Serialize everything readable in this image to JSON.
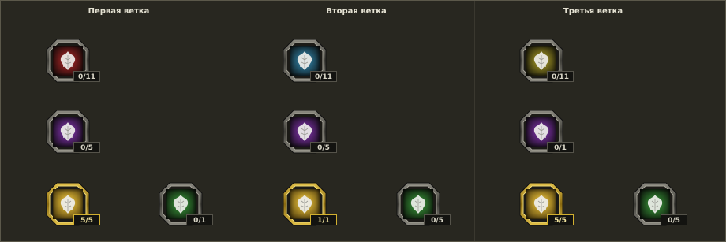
{
  "branches": [
    {
      "title": "Первая ветка",
      "skills": [
        {
          "name": "red",
          "progress": "0/11",
          "glow": "#8a1f1f"
        },
        {
          "name": "purple",
          "progress": "0/5",
          "glow": "#6a2a8e"
        },
        {
          "name": "gold",
          "progress": "5/5",
          "glow": "#b8962a",
          "active": true
        },
        {
          "name": "green",
          "progress": "0/1",
          "glow": "#2e7a2e"
        }
      ]
    },
    {
      "title": "Вторая ветка",
      "skills": [
        {
          "name": "blue",
          "progress": "0/11",
          "glow": "#2a6f8e"
        },
        {
          "name": "purple",
          "progress": "0/5",
          "glow": "#6a2a8e"
        },
        {
          "name": "gold",
          "progress": "1/1",
          "glow": "#b8962a",
          "active": true
        },
        {
          "name": "green",
          "progress": "0/5",
          "glow": "#2e7a2e"
        }
      ]
    },
    {
      "title": "Третья ветка",
      "skills": [
        {
          "name": "yellow",
          "progress": "0/11",
          "glow": "#8a8020"
        },
        {
          "name": "purple",
          "progress": "0/1",
          "glow": "#6a2a8e"
        },
        {
          "name": "gold",
          "progress": "5/5",
          "glow": "#b8962a",
          "active": true
        },
        {
          "name": "green",
          "progress": "0/5",
          "glow": "#2e7a2e"
        }
      ]
    }
  ]
}
